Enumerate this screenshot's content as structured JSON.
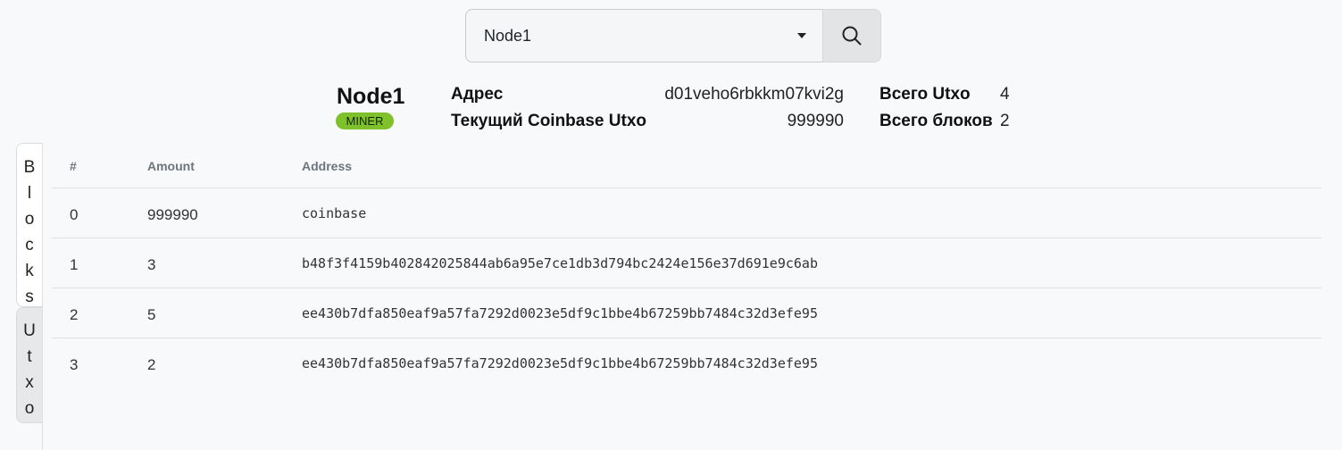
{
  "search": {
    "selected_node": "Node1",
    "button_icon": "search-icon"
  },
  "node": {
    "name": "Node1",
    "badge": "MINER",
    "address_label": "Адрес",
    "address_value": "d01veho6rbkkm07kvi2g",
    "coinbase_label": "Текущий Coinbase Utxo",
    "coinbase_value": "999990",
    "total_utxo_label": "Всего Utxo",
    "total_utxo_value": "4",
    "total_blocks_label": "Всего блоков",
    "total_blocks_value": "2"
  },
  "side_tabs": [
    {
      "label": "Blocks",
      "active": true
    },
    {
      "label": "Utxo",
      "active": false
    }
  ],
  "table": {
    "headers": [
      "#",
      "Amount",
      "Address"
    ],
    "rows": [
      {
        "index": "0",
        "amount": "999990",
        "address": "coinbase"
      },
      {
        "index": "1",
        "amount": "3",
        "address": "b48f3f4159b402842025844ab6a95e7ce1db3d794bc2424e156e37d691e9c6ab"
      },
      {
        "index": "2",
        "amount": "5",
        "address": "ee430b7dfa850eaf9a57fa7292d0023e5df9c1bbe4b67259bb7484c32d3efe95"
      },
      {
        "index": "3",
        "amount": "2",
        "address": "ee430b7dfa850eaf9a57fa7292d0023e5df9c1bbe4b67259bb7484c32d3efe95"
      }
    ]
  },
  "colors": {
    "badge": "#7ec12a",
    "background": "#f8f9fa"
  }
}
